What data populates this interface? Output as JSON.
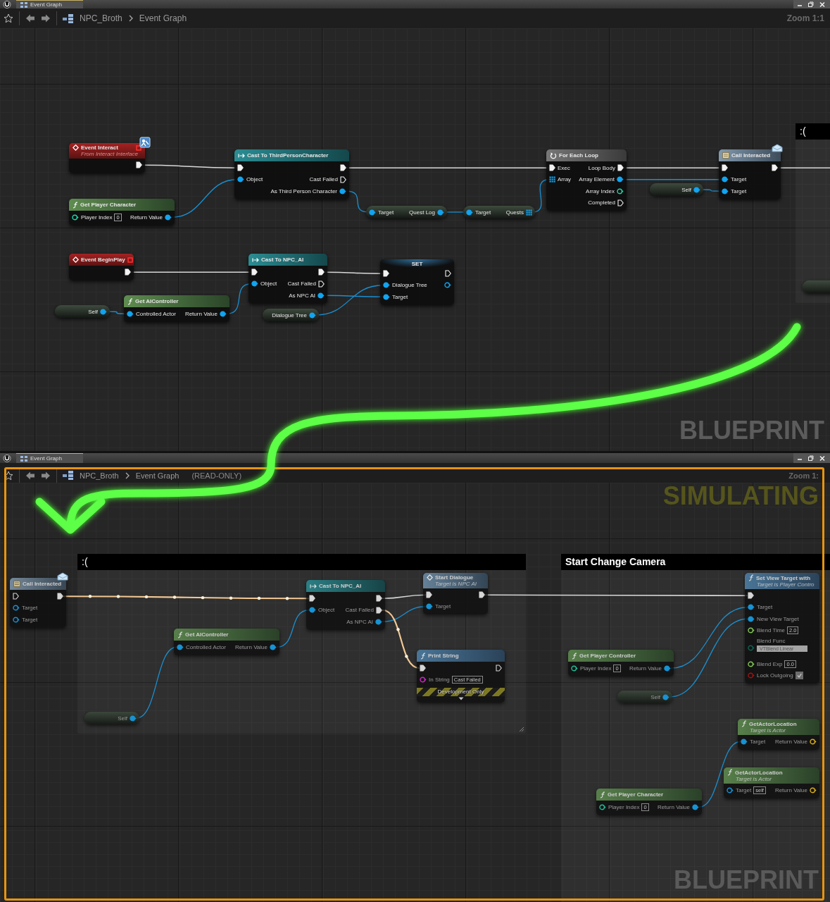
{
  "panels": [
    {
      "tab": {
        "label": "Event Graph",
        "selected": true
      },
      "breadcrumb": [
        "NPC_Broth",
        "Event Graph"
      ],
      "zoom": "Zoom 1:1",
      "simulating": false,
      "watermark": "BLUEPRINT",
      "comments": [
        {
          "title": ":("
        }
      ],
      "nodes": [
        {
          "kind": "event",
          "title": "Event Interact",
          "subtitle": "From Interact Interface",
          "interface_badge": true,
          "outputs": [
            {
              "kind": "exec",
              "linked": true
            }
          ]
        },
        {
          "kind": "pure",
          "title": "Get Player Character",
          "inputs": [
            {
              "label": "Player Index",
              "kind": "int",
              "linked": false,
              "value": "0"
            }
          ],
          "outputs": [
            {
              "label": "Return Value",
              "kind": "object",
              "linked": true
            }
          ]
        },
        {
          "kind": "cast",
          "title": "Cast To ThirdPersonCharacter",
          "inputs": [
            {
              "kind": "exec",
              "linked": true
            },
            {
              "label": "Object",
              "kind": "object",
              "linked": true
            }
          ],
          "outputs": [
            {
              "kind": "exec",
              "linked": true
            },
            {
              "label": "Cast Failed",
              "kind": "exec",
              "linked": false
            },
            {
              "label": "As Third Person Character",
              "kind": "object",
              "linked": true
            }
          ]
        },
        {
          "kind": "getter",
          "inputs": [
            {
              "label": "Target",
              "kind": "object",
              "linked": true
            }
          ],
          "outputs": [
            {
              "label": "Quest Log",
              "kind": "object",
              "linked": true
            }
          ]
        },
        {
          "kind": "getter",
          "inputs": [
            {
              "label": "Target",
              "kind": "object",
              "linked": true
            }
          ],
          "outputs": [
            {
              "label": "Quests",
              "kind": "array",
              "linked": true
            }
          ]
        },
        {
          "kind": "macro",
          "title": "For Each Loop",
          "inputs": [
            {
              "label": "Exec",
              "kind": "exec",
              "linked": true
            },
            {
              "label": "Array",
              "kind": "array",
              "linked": true
            }
          ],
          "outputs": [
            {
              "label": "Loop Body",
              "kind": "exec",
              "linked": true
            },
            {
              "label": "Array Element",
              "kind": "object",
              "linked": true
            },
            {
              "label": "Array Index",
              "kind": "int",
              "linked": false
            },
            {
              "label": "Completed",
              "kind": "exec",
              "linked": false
            }
          ]
        },
        {
          "kind": "variable",
          "outputs": [
            {
              "label": "Self",
              "kind": "object",
              "linked": true
            }
          ]
        },
        {
          "kind": "message",
          "title": "Call Interacted",
          "inputs": [
            {
              "kind": "exec",
              "linked": true
            },
            {
              "label": "Target",
              "kind": "object",
              "linked": true
            },
            {
              "label": "Target",
              "kind": "object",
              "linked": true
            }
          ],
          "outputs": [
            {
              "kind": "exec",
              "linked": true
            }
          ]
        },
        {
          "kind": "event",
          "title": "Event BeginPlay",
          "outputs": [
            {
              "kind": "exec",
              "linked": true
            }
          ]
        },
        {
          "kind": "cast",
          "title": "Cast To NPC_AI",
          "inputs": [
            {
              "kind": "exec",
              "linked": true
            },
            {
              "label": "Object",
              "kind": "object",
              "linked": true
            }
          ],
          "outputs": [
            {
              "kind": "exec",
              "linked": true
            },
            {
              "label": "Cast Failed",
              "kind": "exec",
              "linked": false
            },
            {
              "label": "As NPC AI",
              "kind": "object",
              "linked": true
            }
          ]
        },
        {
          "kind": "set",
          "title": "SET",
          "inputs": [
            {
              "kind": "exec",
              "linked": true
            },
            {
              "label": "Dialogue Tree",
              "kind": "object",
              "linked": true
            },
            {
              "label": "Target",
              "kind": "object",
              "linked": true
            }
          ],
          "outputs": [
            {
              "kind": "exec",
              "linked": false
            },
            {
              "kind": "object",
              "linked": false
            }
          ]
        },
        {
          "kind": "variable",
          "outputs": [
            {
              "label": "Self",
              "kind": "object",
              "linked": true
            }
          ]
        },
        {
          "kind": "pure",
          "title": "Get AIController",
          "inputs": [
            {
              "label": "Controlled Actor",
              "kind": "object",
              "linked": true
            }
          ],
          "outputs": [
            {
              "label": "Return Value",
              "kind": "object",
              "linked": true
            }
          ]
        },
        {
          "kind": "variable",
          "outputs": [
            {
              "label": "Dialogue Tree",
              "kind": "object",
              "linked": true
            }
          ]
        },
        {
          "kind": "variable"
        }
      ]
    },
    {
      "tab": {
        "label": "Event Graph",
        "selected": true
      },
      "breadcrumb": [
        "NPC_Broth",
        "Event Graph"
      ],
      "read_only_label": "(READ-ONLY)",
      "zoom": "Zoom 1:",
      "simulating": true,
      "status_label": "SIMULATING",
      "watermark": "BLUEPRINT",
      "comments": [
        {
          "title": ":("
        },
        {
          "title": "Start Change Camera"
        }
      ],
      "nodes": [
        {
          "kind": "message",
          "title": "Call Interacted",
          "inputs": [
            {
              "kind": "exec",
              "linked": false
            },
            {
              "label": "Target",
              "kind": "object",
              "linked": false
            },
            {
              "label": "Target",
              "kind": "object",
              "linked": false
            }
          ],
          "outputs": [
            {
              "kind": "exec",
              "linked": true
            }
          ]
        },
        {
          "kind": "cast",
          "title": "Cast To NPC_AI",
          "inputs": [
            {
              "kind": "exec",
              "linked": true
            },
            {
              "label": "Object",
              "kind": "object",
              "linked": true
            }
          ],
          "outputs": [
            {
              "kind": "exec",
              "linked": true
            },
            {
              "label": "Cast Failed",
              "kind": "exec",
              "linked": true
            },
            {
              "label": "As NPC AI",
              "kind": "object",
              "linked": true
            }
          ]
        },
        {
          "kind": "interface",
          "title": "Start Dialogue",
          "subtitle": "Target is NPC AI",
          "inputs": [
            {
              "kind": "exec",
              "linked": true
            },
            {
              "label": "Target",
              "kind": "object",
              "linked": true
            }
          ],
          "outputs": [
            {
              "kind": "exec",
              "linked": true
            }
          ]
        },
        {
          "kind": "pure",
          "title": "Get AIController",
          "inputs": [
            {
              "label": "Controlled Actor",
              "kind": "object",
              "linked": true
            }
          ],
          "outputs": [
            {
              "label": "Return Value",
              "kind": "object",
              "linked": true
            }
          ]
        },
        {
          "kind": "variable",
          "outputs": [
            {
              "label": "Self",
              "kind": "object",
              "linked": true
            }
          ]
        },
        {
          "kind": "function",
          "title": "Print String",
          "inputs": [
            {
              "kind": "exec",
              "linked": true
            },
            {
              "label": "In String",
              "kind": "string",
              "linked": false,
              "value": "Cast Failed"
            }
          ],
          "outputs": [
            {
              "kind": "exec",
              "linked": false
            }
          ],
          "banner": "Development Only"
        },
        {
          "kind": "pure",
          "title": "Get Player Controller",
          "inputs": [
            {
              "label": "Player Index",
              "kind": "int",
              "linked": false,
              "value": "0"
            }
          ],
          "outputs": [
            {
              "label": "Return Value",
              "kind": "object",
              "linked": true
            }
          ]
        },
        {
          "kind": "variable",
          "outputs": [
            {
              "label": "Self",
              "kind": "object",
              "linked": true
            }
          ]
        },
        {
          "kind": "function",
          "title": "Set View Target with",
          "subtitle": "Target is Player Contro",
          "inputs": [
            {
              "kind": "exec",
              "linked": true
            },
            {
              "label": "Target",
              "kind": "object",
              "linked": true
            },
            {
              "label": "New View Target",
              "kind": "object",
              "linked": true
            },
            {
              "label": "Blend Time",
              "kind": "float",
              "linked": false,
              "value": "2.0"
            },
            {
              "label": "Blend Func",
              "kind": "enum",
              "linked": false,
              "value": "VTBlend Linear"
            },
            {
              "label": "Blend Exp",
              "kind": "float",
              "linked": false,
              "value": "0.0"
            },
            {
              "label": "Lock Outgoing",
              "kind": "bool",
              "linked": false,
              "checked": true
            }
          ]
        },
        {
          "kind": "pure",
          "title": "GetActorLocation",
          "subtitle": "Target is Actor",
          "inputs": [
            {
              "label": "Target",
              "kind": "object",
              "linked": true
            }
          ],
          "outputs": [
            {
              "label": "Return Value",
              "kind": "struct",
              "linked": false
            }
          ]
        },
        {
          "kind": "pure",
          "title": "GetActorLocation",
          "subtitle": "Target is Actor",
          "inputs": [
            {
              "label": "Target",
              "kind": "object",
              "linked": false,
              "value": "self"
            }
          ],
          "outputs": [
            {
              "label": "Return Value",
              "kind": "struct",
              "linked": false
            }
          ]
        },
        {
          "kind": "pure",
          "title": "Get Player Character",
          "inputs": [
            {
              "label": "Player Index",
              "kind": "int",
              "linked": false,
              "value": "0"
            }
          ],
          "outputs": [
            {
              "label": "Return Value",
              "kind": "object",
              "linked": true
            }
          ]
        }
      ]
    }
  ]
}
